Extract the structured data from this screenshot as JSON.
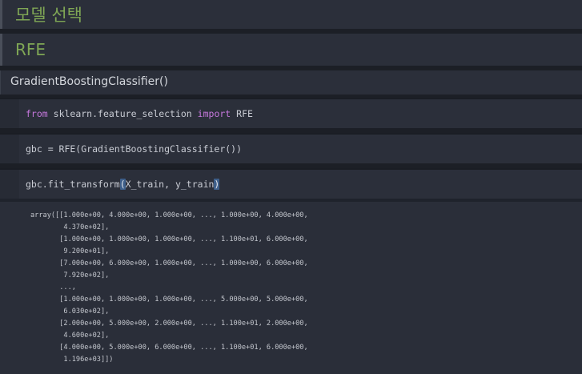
{
  "markdown": {
    "heading1": "모델 선택",
    "heading2": "RFE",
    "subtext": "GradientBoostingClassifier()"
  },
  "code": {
    "cell1": {
      "kw_from": "from",
      "module": "sklearn.feature_selection",
      "kw_import": "import",
      "name": "RFE"
    },
    "cell2": {
      "line": "gbc = RFE(GradientBoostingClassifier())"
    },
    "cell3": {
      "prefix": "gbc.fit_transform",
      "open": "(",
      "args": "X_train, y_train",
      "close": ")"
    }
  },
  "output": {
    "lines": [
      "array([[1.000e+00, 4.000e+00, 1.000e+00, ..., 1.000e+00, 4.000e+00,",
      "        4.370e+02],",
      "       [1.000e+00, 1.000e+00, 1.000e+00, ..., 1.100e+01, 6.000e+00,",
      "        9.200e+01],",
      "       [7.000e+00, 6.000e+00, 1.000e+00, ..., 1.000e+00, 6.000e+00,",
      "        7.920e+02],",
      "       ...,",
      "       [1.000e+00, 1.000e+00, 1.000e+00, ..., 5.000e+00, 5.000e+00,",
      "        6.030e+02],",
      "       [2.000e+00, 5.000e+00, 2.000e+00, ..., 1.100e+01, 2.000e+00,",
      "        4.600e+02],",
      "       [4.000e+00, 5.000e+00, 6.000e+00, ..., 1.100e+01, 6.000e+00,",
      "        1.196e+03]])"
    ]
  }
}
